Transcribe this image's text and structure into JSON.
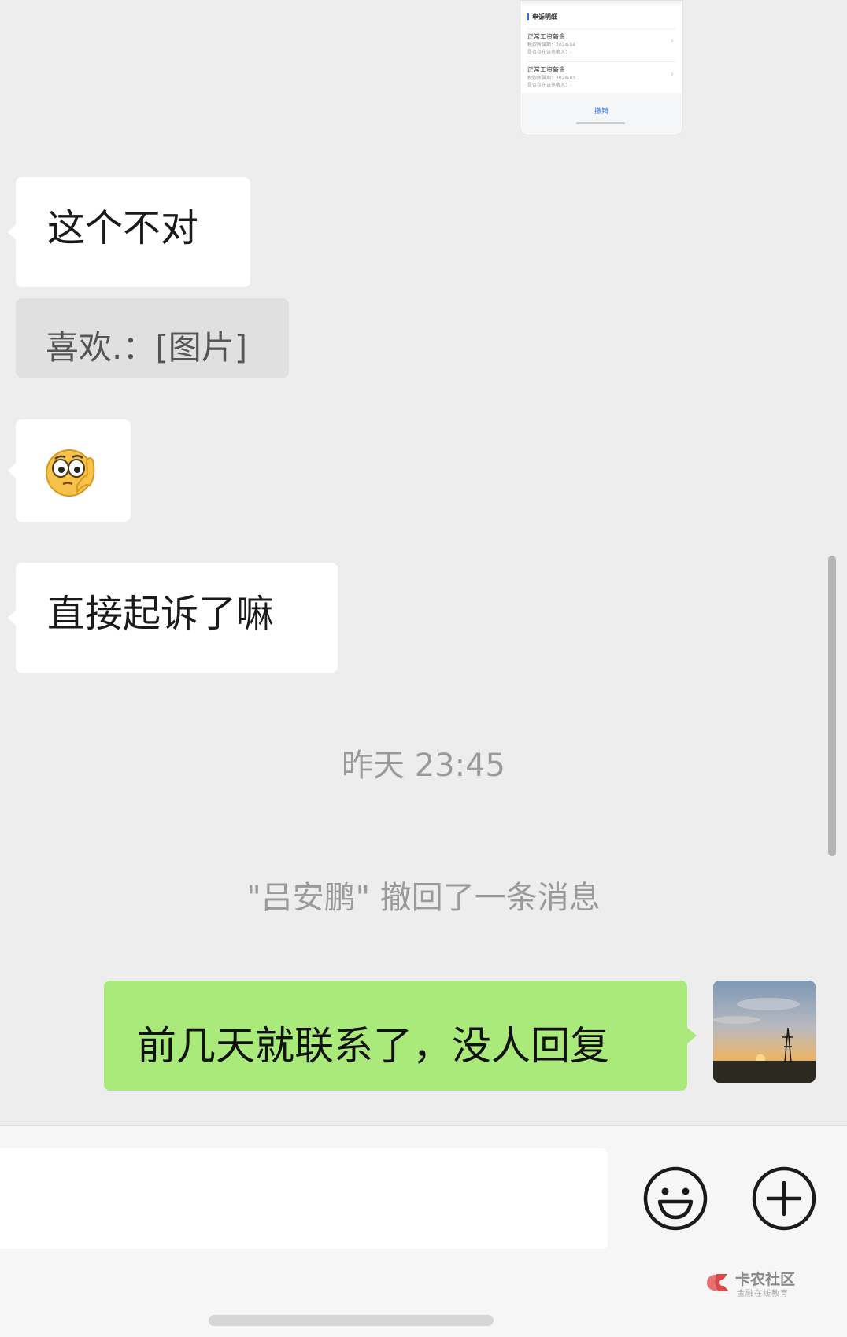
{
  "screenshot_thumb": {
    "title": "申诉明细",
    "rows": [
      {
        "name": "正常工资薪金",
        "period": "税款所属期：2024-04",
        "status": "是否存在该笔收入：-"
      },
      {
        "name": "正常工资薪金",
        "period": "税款所属期：2024-03",
        "status": "是否存在该笔收入：-"
      }
    ],
    "action": "撤销"
  },
  "messages": {
    "m1": "这个不对",
    "quote": "喜欢.：[图片]",
    "m3_emoji": "thinking-face",
    "m4": "直接起诉了嘛",
    "timestamp": "昨天 23:45",
    "recall_notice": "\"吕安鹏\" 撤回了一条消息",
    "outgoing": "前几天就联系了，没人回复"
  },
  "input": {
    "emoji_button": "smiley-icon",
    "more_button": "plus-icon"
  },
  "watermark": {
    "name": "卡农社区",
    "slogan": "金融在线教育"
  },
  "colors": {
    "background": "#ededed",
    "incoming_bubble": "#ffffff",
    "outgoing_bubble": "#a9ea7a",
    "quote_bubble": "#e0e0e0",
    "system_text": "#9a9a9a"
  }
}
